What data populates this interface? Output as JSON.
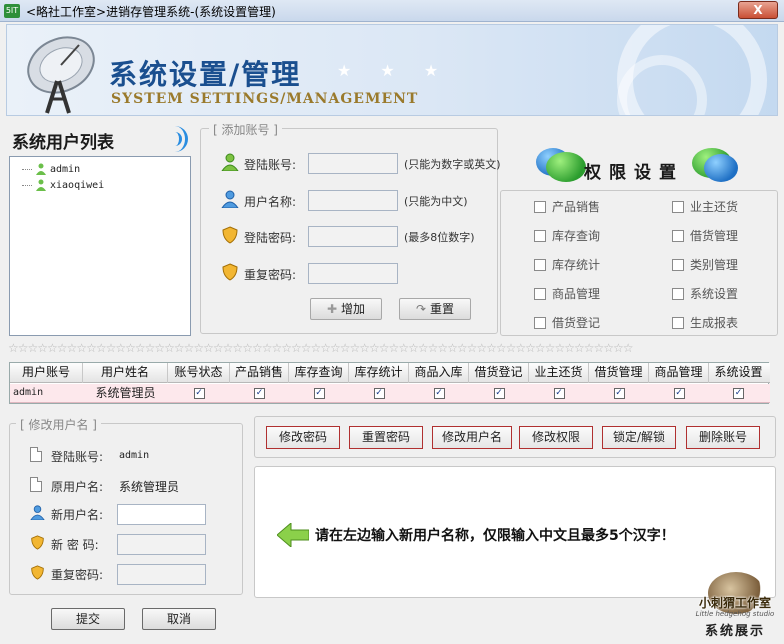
{
  "window": {
    "title": "<略社工作室>进销存管理系统-(系统设置管理)",
    "app_icon_text": "5IT",
    "close_label": "X"
  },
  "banner": {
    "title": "系统设置/管理",
    "stars": "★ ★ ★",
    "subtitle": "SYSTEM SETTINGS/MANAGEMENT"
  },
  "user_list": {
    "title": "系统用户列表",
    "users": [
      "admin",
      "xiaoqiwei"
    ]
  },
  "add_account": {
    "legend": "[ 添加账号 ]",
    "fields": [
      {
        "label": "登陆账号:",
        "hint": "(只能为数字或英文)",
        "value": ""
      },
      {
        "label": "用户名称:",
        "hint": "(只能为中文)",
        "value": ""
      },
      {
        "label": "登陆密码:",
        "hint": "(最多8位数字)",
        "value": ""
      },
      {
        "label": "重复密码:",
        "hint": "",
        "value": ""
      }
    ],
    "add_button": "增加",
    "reset_button": "重置"
  },
  "permissions": {
    "title": "权限设置",
    "items": [
      "产品销售",
      "业主还货",
      "库存查询",
      "借货管理",
      "库存统计",
      "类别管理",
      "商品管理",
      "系统设置",
      "借货登记",
      "生成报表"
    ]
  },
  "divider_stars": "☆☆☆☆☆☆☆☆☆☆☆☆☆☆☆☆☆☆☆☆☆☆☆☆☆☆☆☆☆☆☆☆☆☆☆☆☆☆☆☆☆☆☆☆☆☆☆☆☆☆☆☆☆☆☆☆☆☆☆☆☆☆☆☆",
  "grid": {
    "columns": [
      "用户账号",
      "用户姓名",
      "账号状态",
      "产品销售",
      "库存查询",
      "库存统计",
      "商品入库",
      "借货登记",
      "业主还货",
      "借货管理",
      "商品管理",
      "系统设置"
    ],
    "rows": [
      {
        "account": "admin",
        "name": "系统管理员",
        "checks": [
          true,
          true,
          true,
          true,
          true,
          true,
          true,
          true,
          true,
          true
        ]
      }
    ]
  },
  "modify_user": {
    "legend": "[ 修改用户名 ]",
    "login_label": "登陆账号:",
    "login_value": "admin",
    "orig_label": "原用户名:",
    "orig_value": "系统管理员",
    "new_label": "新用户名:",
    "new_value": "",
    "pwd_label": "新 密 码:",
    "pwd2_label": "重复密码:",
    "submit": "提交",
    "cancel": "取消"
  },
  "actions": [
    "修改密码",
    "重置密码",
    "修改用户名",
    "修改权限",
    "锁定/解锁",
    "删除账号"
  ],
  "message": "请在左边输入新用户名称，仅限输入中文且最多5个汉字！",
  "watermark": {
    "line1": "小刺猬工作室",
    "line2": "Little hedgehog studio",
    "line3": "系统展示"
  },
  "colors": {
    "accent_blue": "#1a4f8f",
    "row_highlight": "#fde8ec",
    "action_border": "#b03030"
  }
}
